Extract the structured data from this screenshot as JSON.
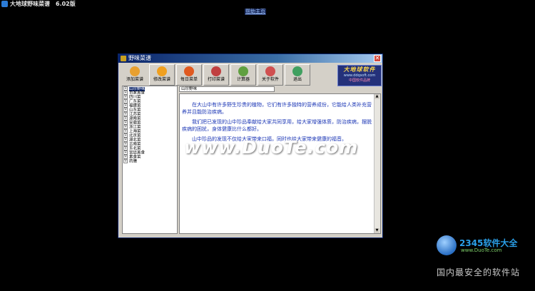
{
  "outer": {
    "title": "大地球野味菜谱　6.02版",
    "top_link": "帮助主页"
  },
  "window": {
    "title": "野味菜谱",
    "close_glyph": "✕"
  },
  "toolbar": {
    "buttons": [
      {
        "label": "添加菜谱",
        "icon": "add-recipe-icon",
        "color": "#e8a030"
      },
      {
        "label": "修改菜谱",
        "icon": "edit-recipe-icon",
        "color": "#f0a020"
      },
      {
        "label": "每日菜单",
        "icon": "daily-menu-icon",
        "color": "#e05a20"
      },
      {
        "label": "打印菜谱",
        "icon": "print-icon",
        "color": "#c04040"
      },
      {
        "label": "计算器",
        "icon": "calculator-icon",
        "color": "#60a040"
      },
      {
        "label": "关于软件",
        "icon": "about-icon",
        "color": "#d05050"
      },
      {
        "label": "退出",
        "icon": "exit-icon",
        "color": "#40a060"
      }
    ],
    "logo": {
      "line1": "大地球软件",
      "line2": "www.ddqsoft.com",
      "line3": "中国软件品牌"
    }
  },
  "tree": {
    "items": [
      {
        "label": "山珍野味",
        "selected": true
      },
      {
        "label": "百家美食"
      },
      {
        "label": "四川菜"
      },
      {
        "label": "广东菜"
      },
      {
        "label": "福建菜"
      },
      {
        "label": "山东菜"
      },
      {
        "label": "江苏菜"
      },
      {
        "label": "湖南菜"
      },
      {
        "label": "安徽菜"
      },
      {
        "label": "浙江菜"
      },
      {
        "label": "上海菜"
      },
      {
        "label": "北京菜"
      },
      {
        "label": "湖北菜"
      },
      {
        "label": "云南菜"
      },
      {
        "label": "东北菜"
      },
      {
        "label": "宫廷美食"
      },
      {
        "label": "素食菜"
      },
      {
        "label": "药膳"
      }
    ]
  },
  "content": {
    "breadcrumb": "山珍野味",
    "paragraphs": [
      "　　在大山中有许多野生珍贵的植物，它们有许多独特的营养成份，它能给人类补充营养并且能防治疾病。",
      "　　我们把已发现的山中珍品奉献给大家共同享用，给大家增强体质，防治疾病，摆脱疾病的困扰，身体健康比什么都好。",
      "　　山中珍品的发现不仅给大家带来口福，同时也给大家带来健康的福音。"
    ],
    "watermark": "www.DuoTe.com"
  },
  "footer": {
    "logo_text": "2345软件大全",
    "logo_url": "www.DuoTe.com",
    "caption": "国内最安全的软件站"
  }
}
